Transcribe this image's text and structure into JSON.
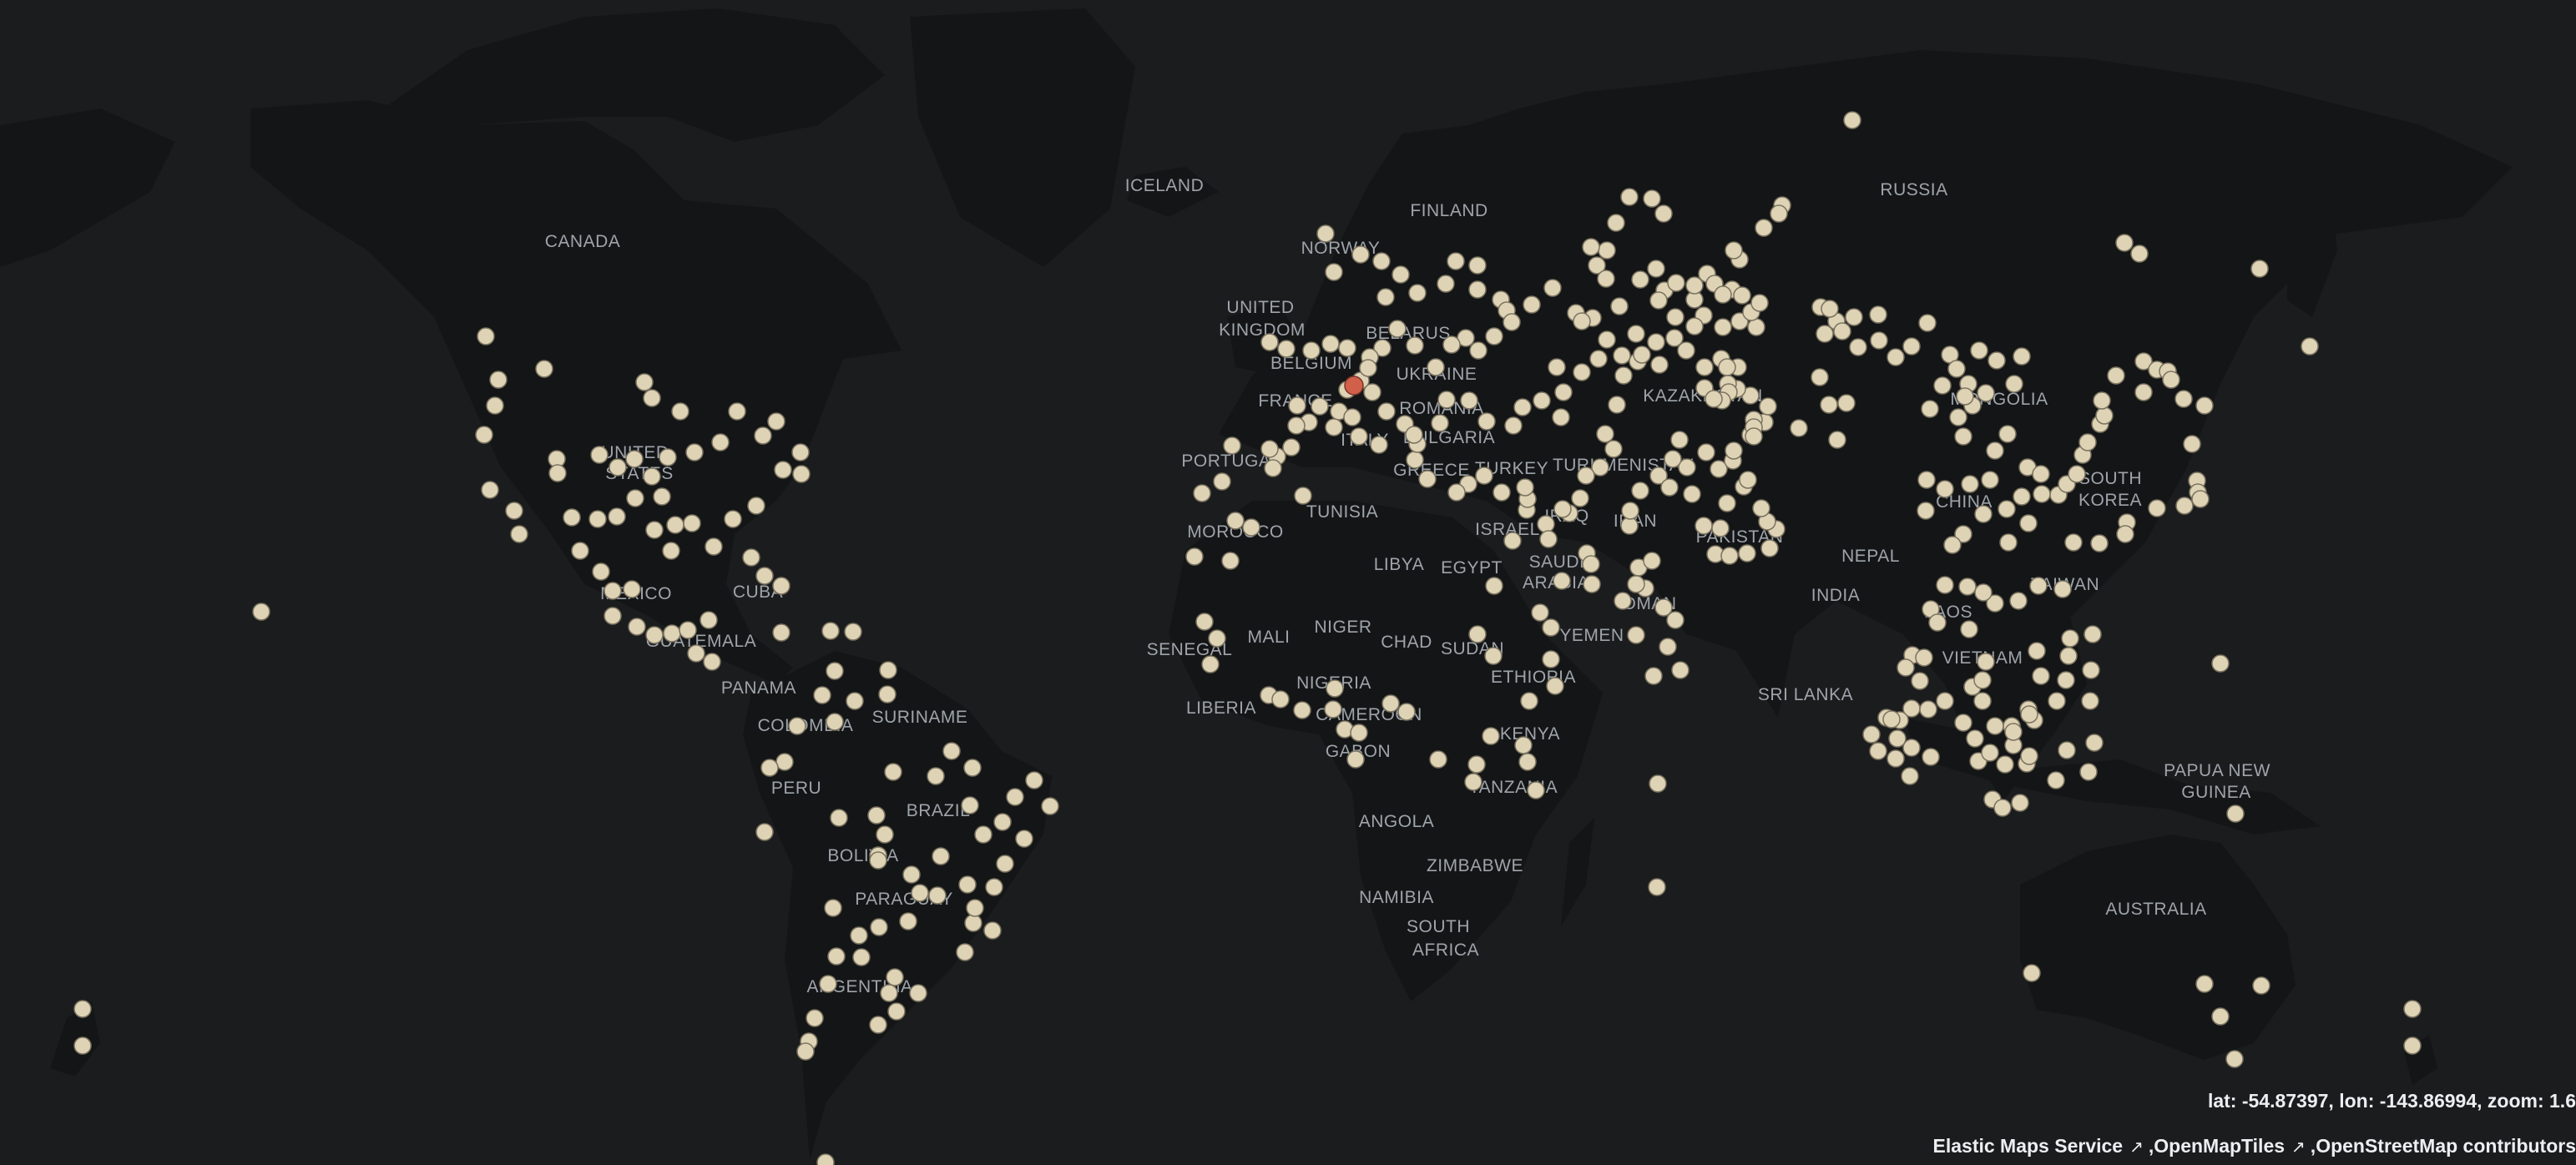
{
  "map": {
    "land_color": "#141516",
    "ocean_color": "#1b1c1d",
    "point_color": "#dfd3b5",
    "selected_point_color": "#d1604a",
    "labels": [
      "ICELAND",
      "FINLAND",
      "RUSSIA",
      "NORWAY",
      "CANADA",
      "UNITED",
      "KINGDOM",
      "BELGIUM",
      "BELARUS",
      "UKRAINE",
      "FRANCE",
      "ROMANIA",
      "KAZAKHSTAN",
      "MONGOLIA",
      "BULGARIA",
      "ITALY",
      "PORTUGAL",
      "GREECE",
      "TURKEY",
      "TURKMENISTAN",
      "UNITED",
      "STATES",
      "SOUTH",
      "KOREA",
      "CHINA",
      "TUNISIA",
      "MOROCCO",
      "ISRAEL",
      "IRAQ",
      "IRAN",
      "PAKISTAN",
      "NEPAL",
      "LIBYA",
      "EGYPT",
      "SAUDI",
      "ARABIA",
      "OMAN",
      "INDIA",
      "TAIWAN",
      "MEXICO",
      "CUBA",
      "MALI",
      "NIGER",
      "CHAD",
      "SUDAN",
      "YEMEN",
      "LAOS",
      "GUATEMALA",
      "SENEGAL",
      "ETHIOPIA",
      "VIETNAM",
      "PANAMA",
      "NIGERIA",
      "SRI LANKA",
      "LIBERIA",
      "CAMEROON",
      "SURINAME",
      "COLOMBIA",
      "GABON",
      "KENYA",
      "PAPUA NEW",
      "GUINEA",
      "PERU",
      "TANZANIA",
      "BRAZIL",
      "ANGOLA",
      "BOLIVIA",
      "ZIMBABWE",
      "PARAGUAY",
      "NAMIBIA",
      "AUSTRALIA",
      "SOUTH",
      "AFRICA",
      "ARGENTINA"
    ]
  },
  "readout": {
    "text": "lat: -54.87397, lon: -143.86994, zoom: 1.6"
  },
  "attribution": {
    "elastic": "Elastic Maps Service",
    "omt": "OpenMapTiles",
    "osm": "OpenStreetMap contributors",
    "sep": ","
  }
}
